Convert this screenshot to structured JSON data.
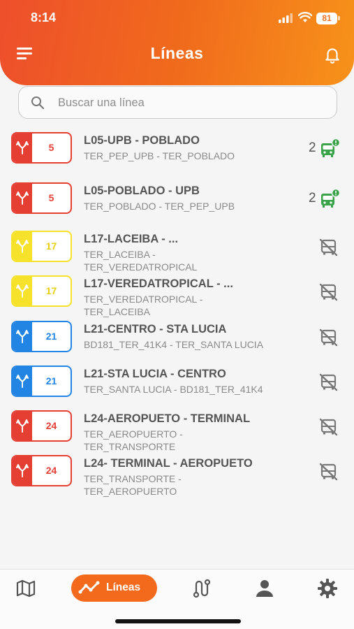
{
  "status_bar": {
    "time": "8:14",
    "battery": "81"
  },
  "header": {
    "title": "Líneas"
  },
  "search": {
    "placeholder": "Buscar una línea",
    "value": ""
  },
  "colors": {
    "red": "#e53f33",
    "yellow": "#f6e22a",
    "blue": "#2284e3",
    "accent": "#f36a1d",
    "green_bus": "#3aa34a"
  },
  "lines": [
    {
      "number": "5",
      "color": "red",
      "title": "L05-UPB - POBLADO",
      "subtitle": "TER_PEP_UPB - TER_POBLADO",
      "buses": "2",
      "status_icon": "bus-active-icon"
    },
    {
      "number": "5",
      "color": "red",
      "title": "L05-POBLADO - UPB",
      "subtitle": "TER_POBLADO - TER_PEP_UPB",
      "buses": "2",
      "status_icon": "bus-active-icon"
    },
    {
      "number": "17",
      "color": "yellow",
      "title": "L17-LACEIBA - ...",
      "subtitle": "TER_LACEIBA - TER_VEREDATROPICAL",
      "buses": "",
      "status_icon": "bus-off-icon"
    },
    {
      "number": "17",
      "color": "yellow",
      "title": "L17-VEREDATROPICAL - ...",
      "subtitle": "TER_VEREDATROPICAL - TER_LACEIBA",
      "buses": "",
      "status_icon": "bus-off-icon"
    },
    {
      "number": "21",
      "color": "blue",
      "title": "L21-CENTRO - STA LUCIA",
      "subtitle": "BD181_TER_41K4 - TER_SANTA LUCIA",
      "buses": "",
      "status_icon": "bus-off-icon"
    },
    {
      "number": "21",
      "color": "blue",
      "title": "L21-STA LUCIA - CENTRO",
      "subtitle": "TER_SANTA LUCIA - BD181_TER_41K4",
      "buses": "",
      "status_icon": "bus-off-icon"
    },
    {
      "number": "24",
      "color": "red",
      "title": "L24-AEROPUETO - TERMINAL",
      "subtitle": "TER_AEROPUERTO - TER_TRANSPORTE",
      "buses": "",
      "status_icon": "bus-off-icon"
    },
    {
      "number": "24",
      "color": "red",
      "title": "L24- TERMINAL - AEROPUETO",
      "subtitle": "TER_TRANSPORTE - TER_AEROPUERTO",
      "buses": "",
      "status_icon": "bus-off-icon"
    }
  ],
  "bottom_nav": {
    "items": [
      {
        "icon": "map-icon"
      },
      {
        "icon": "chart-line-icon",
        "label": "Líneas",
        "active": true
      },
      {
        "icon": "route-icon"
      },
      {
        "icon": "user-icon"
      },
      {
        "icon": "gear-icon"
      }
    ]
  }
}
